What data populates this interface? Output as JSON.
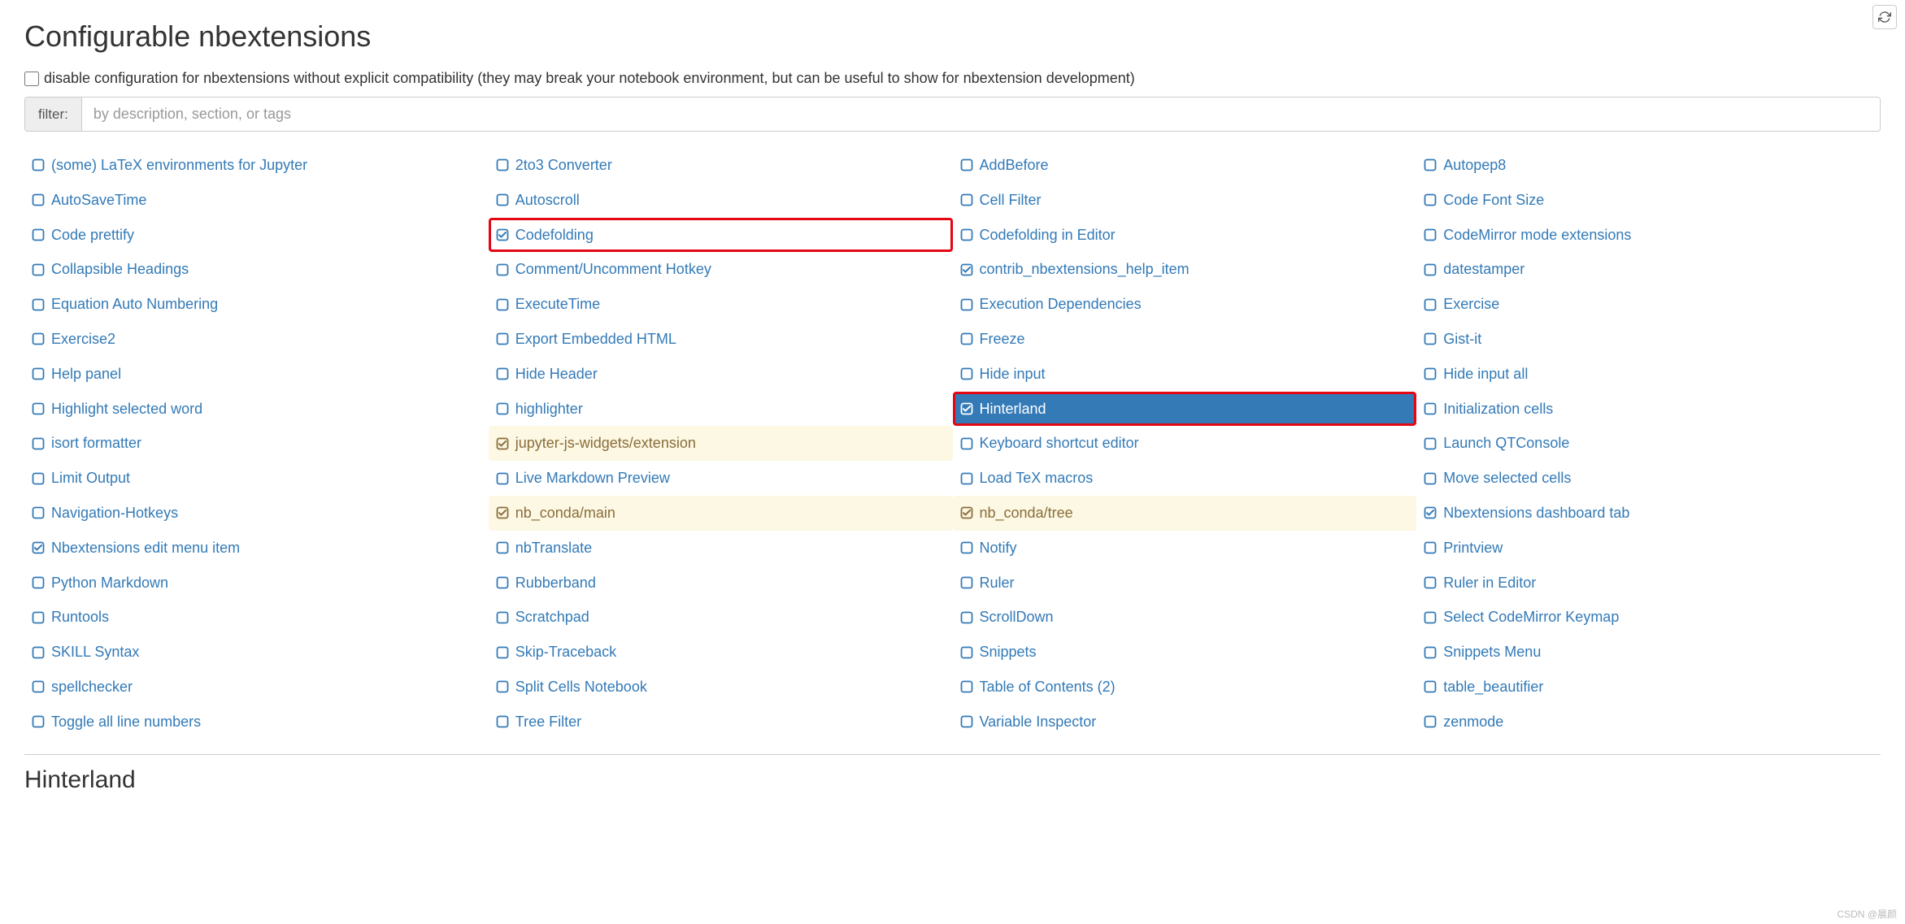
{
  "header": {
    "title": "Configurable nbextensions"
  },
  "disable": {
    "label": "disable configuration for nbextensions without explicit compatibility (they may break your notebook environment, but can be useful to show for nbextension development)"
  },
  "filter": {
    "label": "filter:",
    "placeholder": "by description, section, or tags"
  },
  "extensions": [
    [
      "(some) LaTeX environments for Jupyter",
      "2to3 Converter",
      "AddBefore",
      "Autopep8"
    ],
    [
      "AutoSaveTime",
      "Autoscroll",
      "Cell Filter",
      "Code Font Size"
    ],
    [
      "Code prettify",
      "Codefolding",
      "Codefolding in Editor",
      "CodeMirror mode extensions"
    ],
    [
      "Collapsible Headings",
      "Comment/Uncomment Hotkey",
      "contrib_nbextensions_help_item",
      "datestamper"
    ],
    [
      "Equation Auto Numbering",
      "ExecuteTime",
      "Execution Dependencies",
      "Exercise"
    ],
    [
      "Exercise2",
      "Export Embedded HTML",
      "Freeze",
      "Gist-it"
    ],
    [
      "Help panel",
      "Hide Header",
      "Hide input",
      "Hide input all"
    ],
    [
      "Highlight selected word",
      "highlighter",
      "Hinterland",
      "Initialization cells"
    ],
    [
      "isort formatter",
      "jupyter-js-widgets/extension",
      "Keyboard shortcut editor",
      "Launch QTConsole"
    ],
    [
      "Limit Output",
      "Live Markdown Preview",
      "Load TeX macros",
      "Move selected cells"
    ],
    [
      "Navigation-Hotkeys",
      "nb_conda/main",
      "nb_conda/tree",
      "Nbextensions dashboard tab"
    ],
    [
      "Nbextensions edit menu item",
      "nbTranslate",
      "Notify",
      "Printview"
    ],
    [
      "Python Markdown",
      "Rubberband",
      "Ruler",
      "Ruler in Editor"
    ],
    [
      "Runtools",
      "Scratchpad",
      "ScrollDown",
      "Select CodeMirror Keymap"
    ],
    [
      "SKILL Syntax",
      "Skip-Traceback",
      "Snippets",
      "Snippets Menu"
    ],
    [
      "spellchecker",
      "Split Cells Notebook",
      "Table of Contents (2)",
      "table_beautifier"
    ],
    [
      "Toggle all line numbers",
      "Tree Filter",
      "Variable Inspector",
      "zenmode"
    ]
  ],
  "states": {
    "checked": [
      "Codefolding",
      "contrib_nbextensions_help_item",
      "Hinterland",
      "jupyter-js-widgets/extension",
      "nb_conda/main",
      "nb_conda/tree",
      "Nbextensions dashboard tab",
      "Nbextensions edit menu item"
    ],
    "warn": [
      "jupyter-js-widgets/extension",
      "nb_conda/main",
      "nb_conda/tree"
    ],
    "selected": "Hinterland",
    "highlight_red": [
      "Codefolding",
      "Hinterland"
    ]
  },
  "detail": {
    "title": "Hinterland"
  },
  "watermark": "CSDN @晨颜"
}
